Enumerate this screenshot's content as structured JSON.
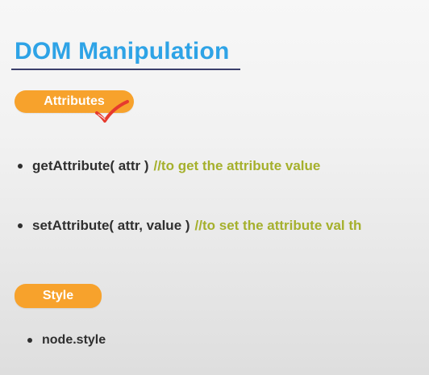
{
  "slide": {
    "title": "DOM Manipulation",
    "sections": {
      "attributes": {
        "label": "Attributes",
        "items": [
          {
            "code": "getAttribute( attr )",
            "comment": "//to get the attribute value"
          },
          {
            "code": "setAttribute( attr, value )",
            "comment": "//to set the attribute val th"
          }
        ]
      },
      "style": {
        "label": "Style",
        "items": [
          {
            "code": "node.style"
          }
        ]
      }
    },
    "icons": {
      "checkmark": "checkmark-icon"
    }
  },
  "colors": {
    "title": "#2ea3e6",
    "title_rule": "#3a3f6b",
    "pill_bg": "#f7a22c",
    "pill_text": "#ffffff",
    "code_text": "#2f2f2f",
    "comment_text": "#a5b02c",
    "check": "#e63a2e"
  }
}
